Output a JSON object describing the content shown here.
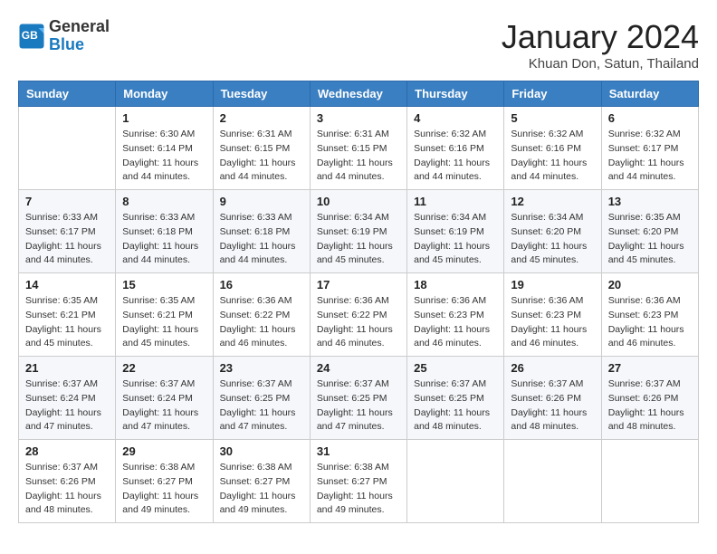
{
  "header": {
    "logo_line1": "General",
    "logo_line2": "Blue",
    "month": "January 2024",
    "location": "Khuan Don, Satun, Thailand"
  },
  "weekdays": [
    "Sunday",
    "Monday",
    "Tuesday",
    "Wednesday",
    "Thursday",
    "Friday",
    "Saturday"
  ],
  "weeks": [
    [
      {
        "day": "",
        "info": ""
      },
      {
        "day": "1",
        "info": "Sunrise: 6:30 AM\nSunset: 6:14 PM\nDaylight: 11 hours\nand 44 minutes."
      },
      {
        "day": "2",
        "info": "Sunrise: 6:31 AM\nSunset: 6:15 PM\nDaylight: 11 hours\nand 44 minutes."
      },
      {
        "day": "3",
        "info": "Sunrise: 6:31 AM\nSunset: 6:15 PM\nDaylight: 11 hours\nand 44 minutes."
      },
      {
        "day": "4",
        "info": "Sunrise: 6:32 AM\nSunset: 6:16 PM\nDaylight: 11 hours\nand 44 minutes."
      },
      {
        "day": "5",
        "info": "Sunrise: 6:32 AM\nSunset: 6:16 PM\nDaylight: 11 hours\nand 44 minutes."
      },
      {
        "day": "6",
        "info": "Sunrise: 6:32 AM\nSunset: 6:17 PM\nDaylight: 11 hours\nand 44 minutes."
      }
    ],
    [
      {
        "day": "7",
        "info": "Sunrise: 6:33 AM\nSunset: 6:17 PM\nDaylight: 11 hours\nand 44 minutes."
      },
      {
        "day": "8",
        "info": "Sunrise: 6:33 AM\nSunset: 6:18 PM\nDaylight: 11 hours\nand 44 minutes."
      },
      {
        "day": "9",
        "info": "Sunrise: 6:33 AM\nSunset: 6:18 PM\nDaylight: 11 hours\nand 44 minutes."
      },
      {
        "day": "10",
        "info": "Sunrise: 6:34 AM\nSunset: 6:19 PM\nDaylight: 11 hours\nand 45 minutes."
      },
      {
        "day": "11",
        "info": "Sunrise: 6:34 AM\nSunset: 6:19 PM\nDaylight: 11 hours\nand 45 minutes."
      },
      {
        "day": "12",
        "info": "Sunrise: 6:34 AM\nSunset: 6:20 PM\nDaylight: 11 hours\nand 45 minutes."
      },
      {
        "day": "13",
        "info": "Sunrise: 6:35 AM\nSunset: 6:20 PM\nDaylight: 11 hours\nand 45 minutes."
      }
    ],
    [
      {
        "day": "14",
        "info": "Sunrise: 6:35 AM\nSunset: 6:21 PM\nDaylight: 11 hours\nand 45 minutes."
      },
      {
        "day": "15",
        "info": "Sunrise: 6:35 AM\nSunset: 6:21 PM\nDaylight: 11 hours\nand 45 minutes."
      },
      {
        "day": "16",
        "info": "Sunrise: 6:36 AM\nSunset: 6:22 PM\nDaylight: 11 hours\nand 46 minutes."
      },
      {
        "day": "17",
        "info": "Sunrise: 6:36 AM\nSunset: 6:22 PM\nDaylight: 11 hours\nand 46 minutes."
      },
      {
        "day": "18",
        "info": "Sunrise: 6:36 AM\nSunset: 6:23 PM\nDaylight: 11 hours\nand 46 minutes."
      },
      {
        "day": "19",
        "info": "Sunrise: 6:36 AM\nSunset: 6:23 PM\nDaylight: 11 hours\nand 46 minutes."
      },
      {
        "day": "20",
        "info": "Sunrise: 6:36 AM\nSunset: 6:23 PM\nDaylight: 11 hours\nand 46 minutes."
      }
    ],
    [
      {
        "day": "21",
        "info": "Sunrise: 6:37 AM\nSunset: 6:24 PM\nDaylight: 11 hours\nand 47 minutes."
      },
      {
        "day": "22",
        "info": "Sunrise: 6:37 AM\nSunset: 6:24 PM\nDaylight: 11 hours\nand 47 minutes."
      },
      {
        "day": "23",
        "info": "Sunrise: 6:37 AM\nSunset: 6:25 PM\nDaylight: 11 hours\nand 47 minutes."
      },
      {
        "day": "24",
        "info": "Sunrise: 6:37 AM\nSunset: 6:25 PM\nDaylight: 11 hours\nand 47 minutes."
      },
      {
        "day": "25",
        "info": "Sunrise: 6:37 AM\nSunset: 6:25 PM\nDaylight: 11 hours\nand 48 minutes."
      },
      {
        "day": "26",
        "info": "Sunrise: 6:37 AM\nSunset: 6:26 PM\nDaylight: 11 hours\nand 48 minutes."
      },
      {
        "day": "27",
        "info": "Sunrise: 6:37 AM\nSunset: 6:26 PM\nDaylight: 11 hours\nand 48 minutes."
      }
    ],
    [
      {
        "day": "28",
        "info": "Sunrise: 6:37 AM\nSunset: 6:26 PM\nDaylight: 11 hours\nand 48 minutes."
      },
      {
        "day": "29",
        "info": "Sunrise: 6:38 AM\nSunset: 6:27 PM\nDaylight: 11 hours\nand 49 minutes."
      },
      {
        "day": "30",
        "info": "Sunrise: 6:38 AM\nSunset: 6:27 PM\nDaylight: 11 hours\nand 49 minutes."
      },
      {
        "day": "31",
        "info": "Sunrise: 6:38 AM\nSunset: 6:27 PM\nDaylight: 11 hours\nand 49 minutes."
      },
      {
        "day": "",
        "info": ""
      },
      {
        "day": "",
        "info": ""
      },
      {
        "day": "",
        "info": ""
      }
    ]
  ]
}
